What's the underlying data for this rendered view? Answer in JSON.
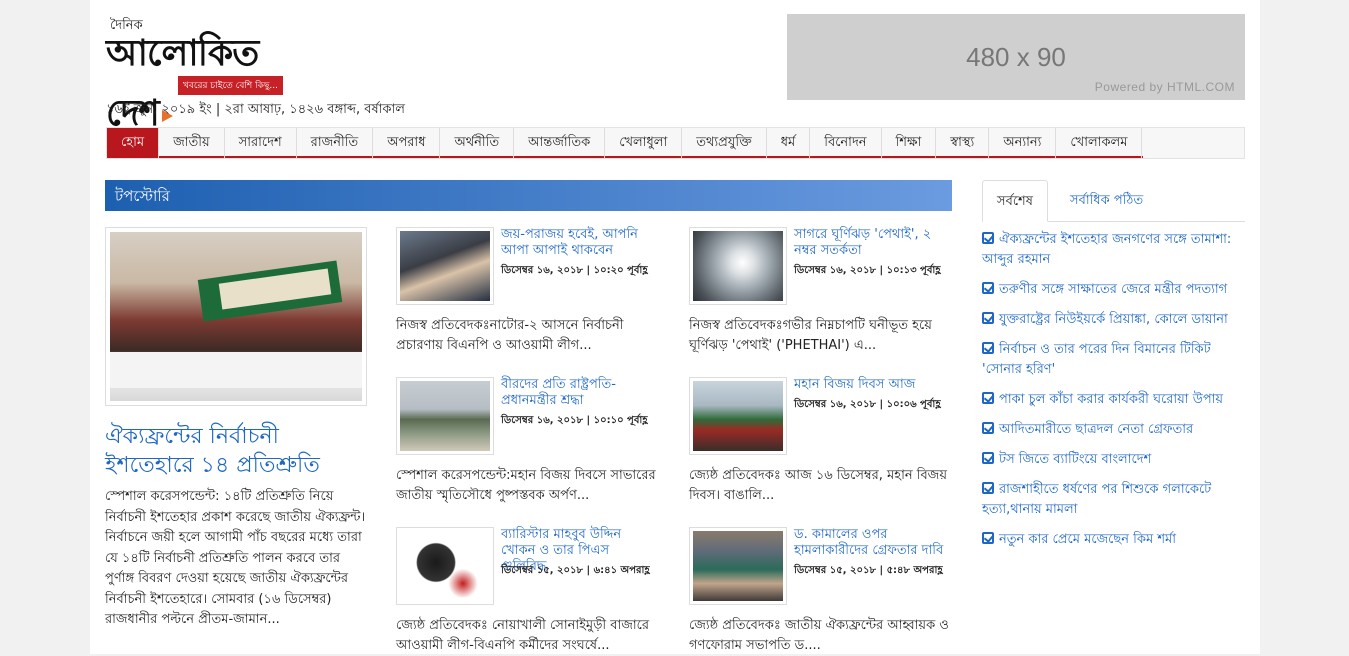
{
  "header": {
    "logo_daily": "দৈনিক",
    "logo_name": "আলোকিত দেশ",
    "logo_tagline": "খবরের চাইতে বেশি কিছু...",
    "date_line": "১৬ই জুন, ২০১৯ ইং | ২রা আষাঢ়, ১৪২৬ বঙ্গাব্দ, বর্ষাকাল"
  },
  "ad": {
    "size": "480 x 90",
    "powered_by": "Powered by HTML.COM"
  },
  "nav": {
    "items": [
      "হোম",
      "জাতীয়",
      "সারাদেশ",
      "রাজনীতি",
      "অপরাধ",
      "অর্থনীতি",
      "আন্তর্জাতিক",
      "খেলাধুলা",
      "তথ্যপ্রযুক্তি",
      "ধর্ম",
      "বিনোদন",
      "শিক্ষা",
      "স্বাস্থ্য",
      "অন্যান্য",
      "খোলাকলম"
    ]
  },
  "top_stories": {
    "section_title": "টপস্টোরি",
    "lead": {
      "title": "ঐক্যফ্রন্টের নির্বাচনী ইশতেহারে ১৪ প্রতিশ্রুতি",
      "body": "স্পেশাল করেসপন্ডেন্ট: ১৪টি প্রতিশ্রুতি নিয়ে নির্বাচনী ইশতেহার প্রকাশ করেছে জাতীয় ঐক্যফ্রন্ট। নির্বাচনে জয়ী হলে আগামী পাঁচ বছরের মধ্যে তারা যে ১৪টি নির্বাচনী প্রতিশ্রুতি পালন করবে তার পুর্ণাঙ্গ বিবরণ দেওয়া হয়েছে জাতীয় ঐক্যফ্রন্টের নির্বাচনী ইশতেহারে। সোমবার (১৬ ডিসেম্বর) রাজধানীর পল্টনে প্রীতম-জামান..."
    },
    "stories": [
      {
        "title": "জয়-পরাজয় হবেই, আপনি আপা আপাই থাকবেন",
        "meta": "ডিসেম্বর ১৬, ২০১৮ | ১০:২০ পূর্বাহ্ণ",
        "excerpt": "নিজস্ব প্রতিবেদকঃনাটোর-২ আসনে নির্বাচনী প্রচারণায় বিএনপি ও আওয়ামী লীগ..."
      },
      {
        "title": "সাগরে ঘূর্ণিঝড় 'পেথাই', ২ নম্বর সতর্কতা",
        "meta": "ডিসেম্বর ১৬, ২০১৮ | ১০:১৩ পূর্বাহ্ণ",
        "excerpt": "নিজস্ব প্রতিবেদকঃগভীর নিম্নচাপটি ঘনীভূত হয়ে ঘূর্ণিঝড় 'পেথাই' ('PHETHAI') এ..."
      },
      {
        "title": "বীরদের প্রতি রাষ্ট্রপতি-প্রধানমন্ত্রীর শ্রদ্ধা",
        "meta": "ডিসেম্বর ১৬, ২০১৮ | ১০:১০ পূর্বাহ্ণ",
        "excerpt": "স্পেশাল করেসপন্ডেন্ট:মহান বিজয় দিবসে সাভারের জাতীয় স্মৃতিসৌধে পুষ্পস্তবক অর্পণ..."
      },
      {
        "title": "মহান বিজয় দিবস আজ",
        "meta": "ডিসেম্বর ১৬, ২০১৮ | ১০:০৬ পূর্বাহ্ণ",
        "excerpt": "জ্যেষ্ঠ প্রতিবেদকঃ আজ ১৬ ডিসেম্বর, মহান বিজয় দিবস। বাঙালি..."
      },
      {
        "title": "ব্যারিস্টার মাহবুব উদ্দিন খোকন ও তার পিএস গুলিবিদ্ধ",
        "meta": "ডিসেম্বর ১৫, ২০১৮ | ৬:৪১ অপরাহ্ণ",
        "excerpt": "জ্যেষ্ঠ প্রতিবেদকঃ নোয়াখালী সোনাইমুড়ী বাজারে আওয়ামী লীগ-বিএনপি কর্মীদের সংঘর্ষে..."
      },
      {
        "title": "ড. কামালের ওপর হামলাকারীদের গ্রেফতার দাবি",
        "meta": "ডিসেম্বর ১৫, ২০১৮ | ৫:৪৮ অপরাহ্ণ",
        "excerpt": "জ্যেষ্ঠ প্রতিবেদকঃ জাতীয় ঐক্যফ্রন্টের আহ্বায়ক ও গণফোরাম সভাপতি ড...."
      }
    ]
  },
  "sidebar": {
    "tabs": [
      "সর্বশেষ",
      "সর্বাধিক পঠিত"
    ],
    "latest": [
      "ঐক্যফ্রন্টের ইশতেহার জনগণের সঙ্গে তামাশা: আব্দুর রহমান",
      "তরুণীর সঙ্গে সাক্ষাতের জেরে মন্ত্রীর পদত্যাগ",
      "যুক্তরাষ্ট্রের নিউইয়র্কে প্রিয়াঙ্কা, কোলে ডায়ানা",
      "নির্বাচন ও তার পরের দিন বিমানের টিকিট 'সোনার হরিণ'",
      "পাকা চুল কাঁচা করার কার্যকরী ঘরোয়া উপায়",
      "আদিতমারীতে ছাত্রদল নেতা গ্রেফতার",
      "টস জিতে ব্যাটিংয়ে বাংলাদেশ",
      "রাজশাহীতে ধর্ষণের পর শিশুকে গলাকেটে হত্যা,থানায় মামলা",
      "নতুন কার প্রেমে মজেছেন কিম শর্মা"
    ]
  }
}
